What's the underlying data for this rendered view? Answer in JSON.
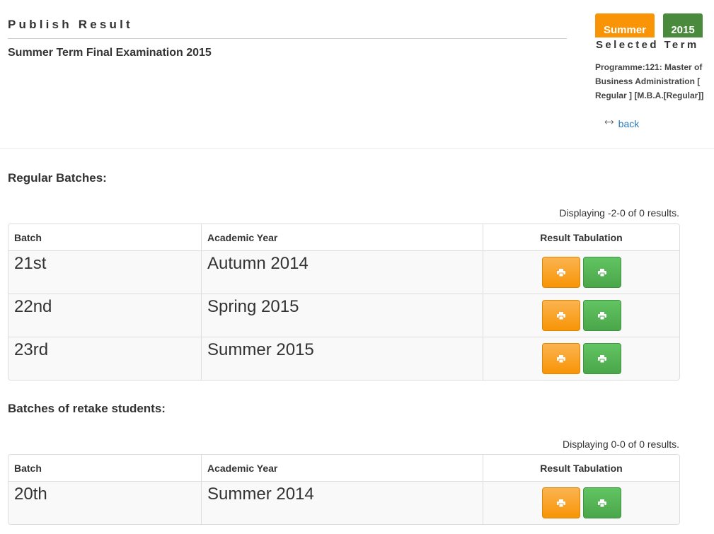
{
  "header": {
    "page_title": "Publish Result",
    "exam_name": "Summer Term Final Examination 2015"
  },
  "term": {
    "season": "Summer",
    "year": "2015",
    "selected_label": "Selected Term",
    "programme": "Programme:121: Master of Business Administration [ Regular ] [M.B.A.[Regular]]",
    "back_label": "back",
    "colors": {
      "season": "#f89406",
      "year": "#4a8a3d"
    }
  },
  "regular": {
    "heading": "Regular Batches:",
    "summary": "Displaying -2-0 of 0 results.",
    "columns": [
      "Batch",
      "Academic Year",
      "Result Tabulation"
    ],
    "rows": [
      {
        "batch": "21st",
        "year": "Autumn 2014"
      },
      {
        "batch": "22nd",
        "year": "Spring 2015"
      },
      {
        "batch": "23rd",
        "year": "Summer 2015"
      }
    ]
  },
  "retake": {
    "heading": "Batches of retake students:",
    "summary": "Displaying 0-0 of 0 results.",
    "columns": [
      "Batch",
      "Academic Year",
      "Result Tabulation"
    ],
    "rows": [
      {
        "batch": "20th",
        "year": "Summer 2014"
      }
    ]
  },
  "icons": {
    "print": "print-icon",
    "back": "arrow-left-icon"
  }
}
